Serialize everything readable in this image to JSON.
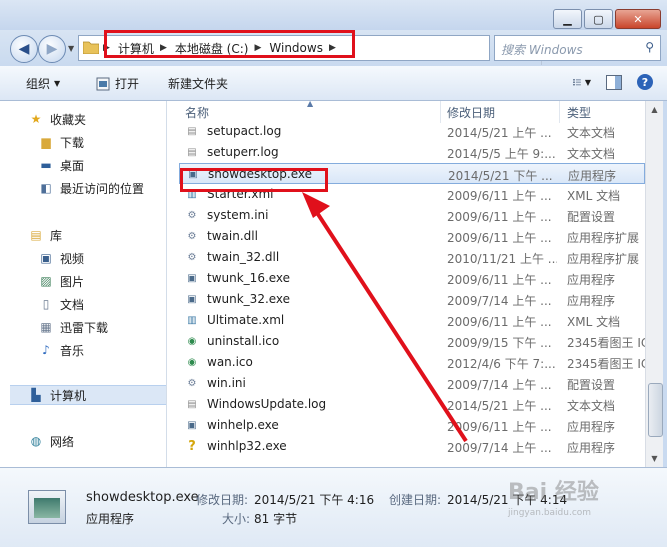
{
  "address": {
    "crumbs": [
      "计算机",
      "本地磁盘 (C:)",
      "Windows"
    ],
    "search_placeholder": "搜索 Windows"
  },
  "toolbar": {
    "organize_label": "组织",
    "open_label": "打开",
    "new_folder_label": "新建文件夹"
  },
  "nav": {
    "favorites": "收藏夹",
    "downloads": "下载",
    "desktop": "桌面",
    "recent": "最近访问的位置",
    "libraries": "库",
    "videos": "视频",
    "pictures": "图片",
    "documents": "文档",
    "xunlei": "迅雷下载",
    "music": "音乐",
    "computer": "计算机",
    "network": "网络"
  },
  "columns": {
    "name": "名称",
    "date": "修改日期",
    "type": "类型"
  },
  "files": [
    {
      "name": "setupact.log",
      "date": "2014/5/21 上午 ...",
      "type": "文本文档",
      "icon": "text-file-icon"
    },
    {
      "name": "setuperr.log",
      "date": "2014/5/5 上午 9:...",
      "type": "文本文档",
      "icon": "text-file-icon"
    },
    {
      "name": "showdesktop.exe",
      "date": "2014/5/21 下午 ...",
      "type": "应用程序",
      "icon": "exe-icon"
    },
    {
      "name": "Starter.xml",
      "date": "2009/6/11 上午 ...",
      "type": "XML 文档",
      "icon": "xml-icon"
    },
    {
      "name": "system.ini",
      "date": "2009/6/11 上午 ...",
      "type": "配置设置",
      "icon": "ini-icon"
    },
    {
      "name": "twain.dll",
      "date": "2009/6/11 上午 ...",
      "type": "应用程序扩展",
      "icon": "dll-icon"
    },
    {
      "name": "twain_32.dll",
      "date": "2010/11/21 上午 ...",
      "type": "应用程序扩展",
      "icon": "dll-icon"
    },
    {
      "name": "twunk_16.exe",
      "date": "2009/6/11 上午 ...",
      "type": "应用程序",
      "icon": "exe-icon"
    },
    {
      "name": "twunk_32.exe",
      "date": "2009/7/14 上午 ...",
      "type": "应用程序",
      "icon": "exe-icon"
    },
    {
      "name": "Ultimate.xml",
      "date": "2009/6/11 上午 ...",
      "type": "XML 文档",
      "icon": "xml-icon"
    },
    {
      "name": "uninstall.ico",
      "date": "2009/9/15 下午 ...",
      "type": "2345看图王 IC",
      "icon": "ico-file-icon"
    },
    {
      "name": "wan.ico",
      "date": "2012/4/6 下午 7:...",
      "type": "2345看图王 IC",
      "icon": "ico-file-icon"
    },
    {
      "name": "win.ini",
      "date": "2009/7/14 上午 ...",
      "type": "配置设置",
      "icon": "ini-icon"
    },
    {
      "name": "WindowsUpdate.log",
      "date": "2014/5/21 上午 ...",
      "type": "文本文档",
      "icon": "text-file-icon"
    },
    {
      "name": "winhelp.exe",
      "date": "2009/6/11 上午 ...",
      "type": "应用程序",
      "icon": "exe-icon"
    },
    {
      "name": "winhlp32.exe",
      "date": "2009/7/14 上午 ...",
      "type": "应用程序",
      "icon": "help-exe-icon"
    }
  ],
  "details": {
    "filename": "showdesktop.exe",
    "filetype": "应用程序",
    "modified_label": "修改日期:",
    "modified_value": "2014/5/21 下午 4:16",
    "created_label": "创建日期:",
    "created_value": "2014/5/21 下午 4:14",
    "size_label": "大小:",
    "size_value": "81 字节"
  },
  "watermark": {
    "text": "Bai 经验",
    "url": "jingyan.baidu.com"
  },
  "colors": {
    "annotation_red": "#e0101b",
    "selection_border": "#84acdd"
  }
}
